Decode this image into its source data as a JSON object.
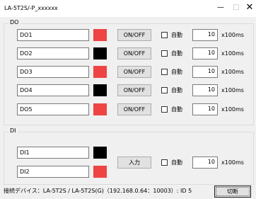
{
  "window": {
    "title": "LA-5T2S/-P_xxxxxx",
    "minimize": "—",
    "maximize": "□",
    "close": "✕"
  },
  "do_group": {
    "title": "DO",
    "rows": [
      {
        "name": "DO1",
        "color": "#ee4444",
        "button": "ON/OFF",
        "auto_label": "自動",
        "interval": "10",
        "unit": "x100ms"
      },
      {
        "name": "DO2",
        "color": "#000000",
        "button": "ON/OFF",
        "auto_label": "自動",
        "interval": "10",
        "unit": "x100ms"
      },
      {
        "name": "DO3",
        "color": "#ee4444",
        "button": "ON/OFF",
        "auto_label": "自動",
        "interval": "10",
        "unit": "x100ms"
      },
      {
        "name": "DO4",
        "color": "#000000",
        "button": "ON/OFF",
        "auto_label": "自動",
        "interval": "10",
        "unit": "x100ms"
      },
      {
        "name": "DO5",
        "color": "#ee4444",
        "button": "ON/OFF",
        "auto_label": "自動",
        "interval": "10",
        "unit": "x100ms"
      }
    ]
  },
  "di_group": {
    "title": "DI",
    "rows": [
      {
        "name": "DI1",
        "color": "#000000"
      },
      {
        "name": "DI2",
        "color": "#ee4444"
      }
    ],
    "input_button": "入力",
    "auto_label": "自動",
    "interval": "10",
    "unit": "x100ms"
  },
  "status": "接続デバイス：LA-5T2S / LA-5T2S(G)（192.168.0.64：10003）: ID 5",
  "disconnect_button": "切断"
}
